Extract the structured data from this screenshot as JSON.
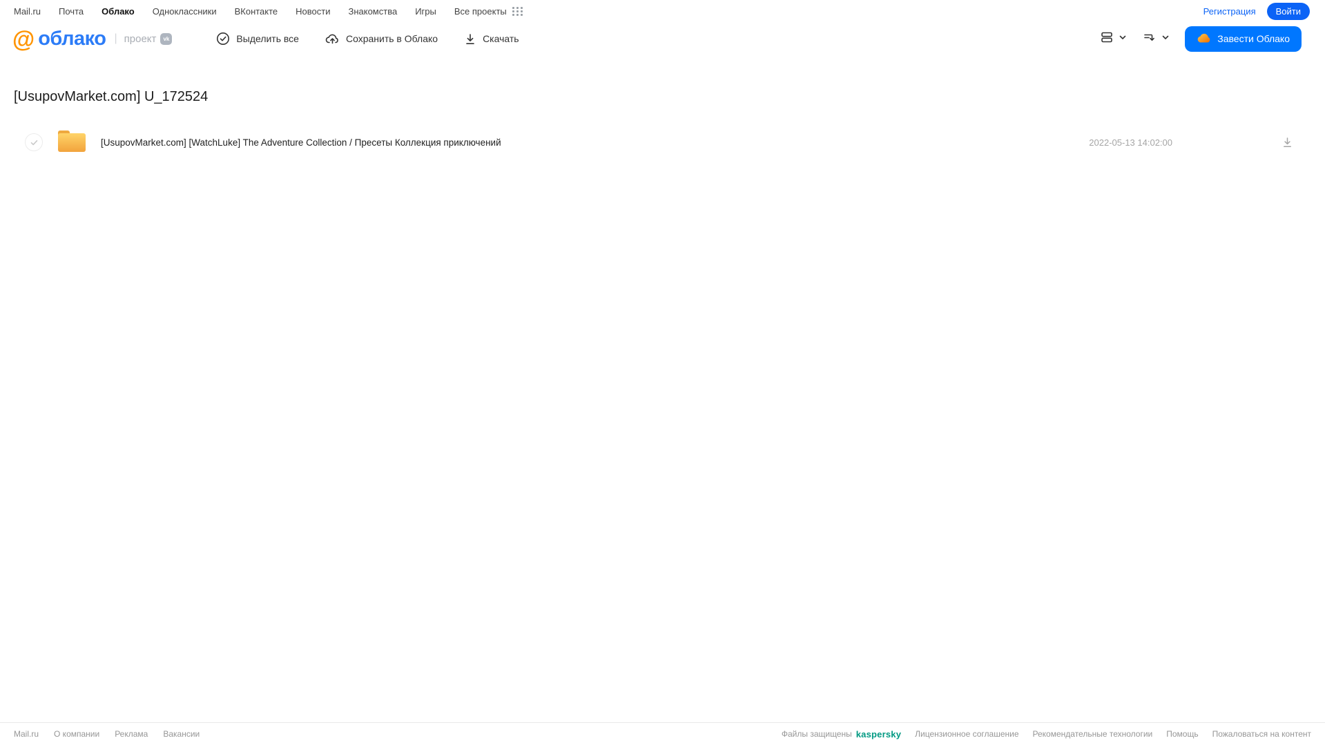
{
  "topbar": {
    "links": [
      {
        "label": "Mail.ru",
        "active": false
      },
      {
        "label": "Почта",
        "active": false
      },
      {
        "label": "Облако",
        "active": true
      },
      {
        "label": "Одноклассники",
        "active": false
      },
      {
        "label": "ВКонтакте",
        "active": false
      },
      {
        "label": "Новости",
        "active": false
      },
      {
        "label": "Знакомства",
        "active": false
      },
      {
        "label": "Игры",
        "active": false
      },
      {
        "label": "Все проекты",
        "active": false
      }
    ],
    "register_label": "Регистрация",
    "login_label": "Войти"
  },
  "header": {
    "logo_at": "@",
    "logo_text": "облако",
    "logo_separator": "|",
    "project_label": "проект",
    "vk_badge_label": "vk",
    "actions": {
      "select_all": "Выделить все",
      "save_to_cloud": "Сохранить в Облако",
      "download": "Скачать"
    },
    "view_icons": [
      "view-mode-icon",
      "sort-order-icon"
    ],
    "get_cloud_label": "Завести Облако"
  },
  "main": {
    "title": "[UsupovMarket.com] U_172524",
    "files": [
      {
        "type": "folder",
        "name": "[UsupovMarket.com] [WatchLuke] The Adventure Collection / Пресеты Коллекция приключений",
        "modified": "2022-05-13 14:02:00"
      }
    ]
  },
  "footer": {
    "left_links": [
      "Mail.ru",
      "О компании",
      "Реклама",
      "Вакансии"
    ],
    "protected_label": "Файлы защищены",
    "kaspersky_label": "kaspersky",
    "right_links": [
      "Лицензионное соглашение",
      "Рекомендательные технологии",
      "Помощь",
      "Пожаловаться на контент"
    ]
  },
  "colors": {
    "accent_blue": "#0077ff",
    "login_blue": "#0b63f6",
    "logo_blue": "#2c7cf7",
    "logo_orange": "#ff9400",
    "folder_top": "#ffd469",
    "folder_bottom": "#f2a33c",
    "kaspersky_teal": "#009982",
    "muted_gray": "#a5a5a5"
  }
}
